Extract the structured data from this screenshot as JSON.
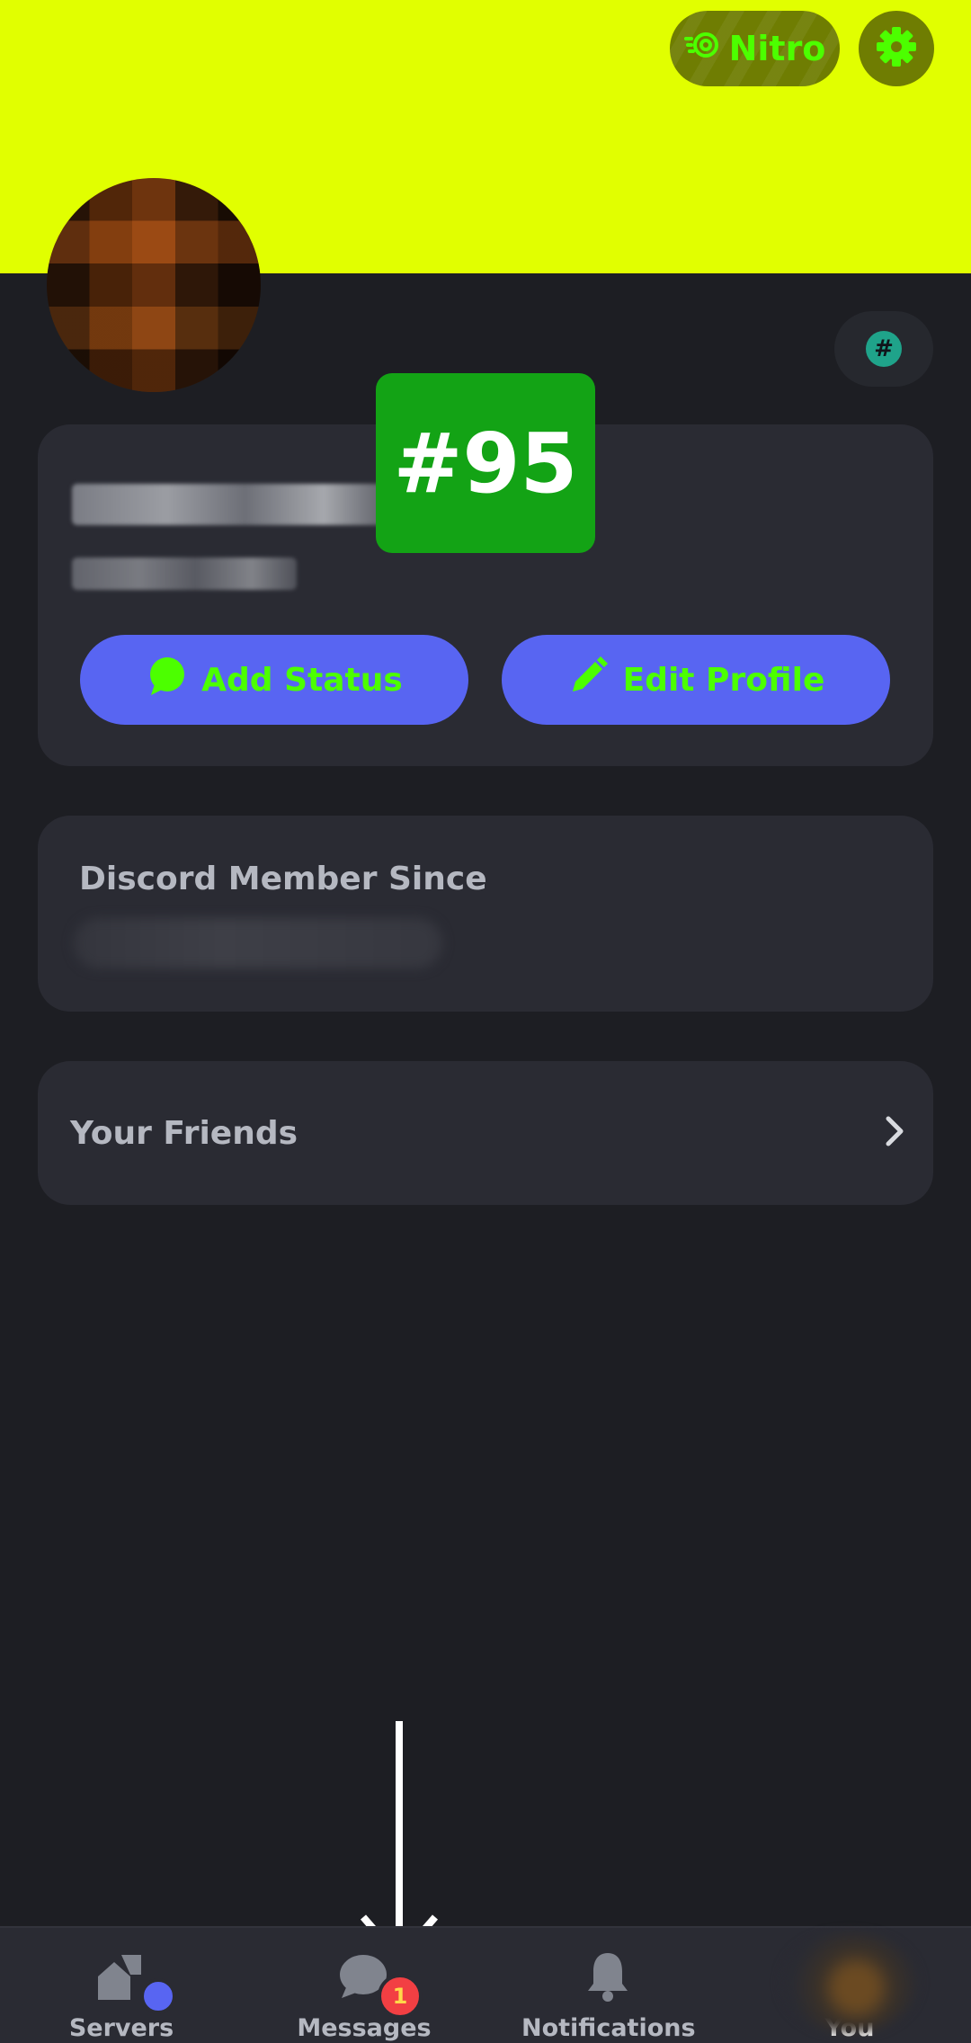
{
  "header": {
    "nitro_label": "Nitro",
    "banner_color": "#e1ff00"
  },
  "profile": {
    "add_status_label": "Add Status",
    "edit_profile_label": "Edit Profile",
    "badge_symbol": "#"
  },
  "member_card": {
    "title": "Discord Member Since"
  },
  "friends_card": {
    "label": "Your Friends"
  },
  "overlay": {
    "marker_label": "#95",
    "marker_color": "#13a315"
  },
  "bottom_nav": {
    "items": [
      {
        "label": "Servers",
        "icon": "servers-icon"
      },
      {
        "label": "Messages",
        "icon": "messages-icon",
        "badge": "1"
      },
      {
        "label": "Notifications",
        "icon": "bell-icon"
      },
      {
        "label": "You",
        "icon": "avatar",
        "active": true
      }
    ]
  },
  "colors": {
    "accent": "#5865f2",
    "button_text": "#4cff00",
    "background": "#1d1e23",
    "card": "#2a2b33"
  }
}
